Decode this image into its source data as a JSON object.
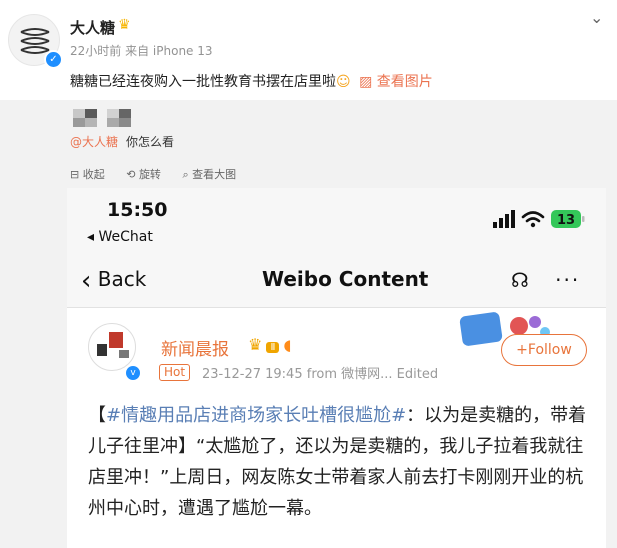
{
  "post": {
    "username": "大人糖",
    "crown_icon": "crown-icon",
    "time": "22小时前",
    "source": "来自 iPhone 13",
    "text": "糖糖已经连夜购入一批性教育书摆在店里啦",
    "view_image_label": "查看图片"
  },
  "comment": {
    "mention": "@大人糖",
    "text": "你怎么看"
  },
  "tools": {
    "collapse": "收起",
    "rotate": "旋转",
    "view_large": "查看大图"
  },
  "phone": {
    "time": "15:50",
    "back_app": "◂ WeChat",
    "battery": "13",
    "nav_back_label": "Back",
    "nav_title": "Weibo Content",
    "card": {
      "name": "新闻晨报",
      "hot_label": "Hot",
      "meta": "23-12-27 19:45  from 微博网...  Edited",
      "follow_label": "+Follow",
      "body": "【#情趣用品店进商场家长吐槽很尴尬#：以为是卖糖的，带着儿子往里冲】“太尴尬了，还以为是卖糖的，我儿子拉着我就往店里冲！”上周日，网友陈女士带着家人前去打卡刚刚开业的杭州中心时，遭遇了尴尬一幕。"
    }
  },
  "colors": {
    "accent_orange": "#eb7350",
    "verified_blue": "#1f8fff",
    "topic_blue": "#5a7fb5"
  }
}
